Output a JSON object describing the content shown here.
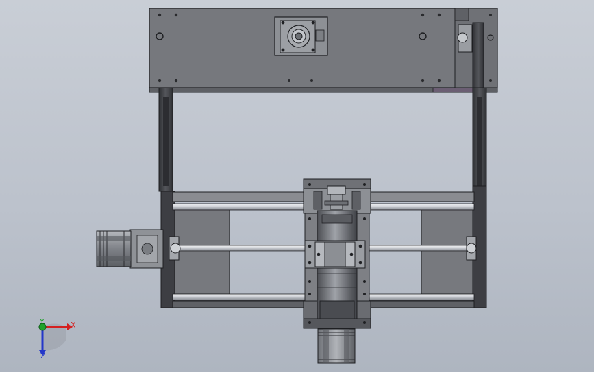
{
  "app": {
    "view": "cad-viewport",
    "background_top": "#c9ced6",
    "background_bottom": "#aeb5c0"
  },
  "triad": {
    "x_label": "X",
    "y_label": "Y",
    "z_label": "Z",
    "x_color": "#d42020",
    "y_color": "#1fa22a",
    "z_color": "#2437c9"
  },
  "model": {
    "plate_color": "#76787d",
    "frame_color": "#3c3d42",
    "rod_color": "#d9dbe0",
    "motor_color": "#8a8d92",
    "icons": [
      "stepper-motor-icon",
      "linear-bearing-icon",
      "spindle-icon"
    ]
  }
}
